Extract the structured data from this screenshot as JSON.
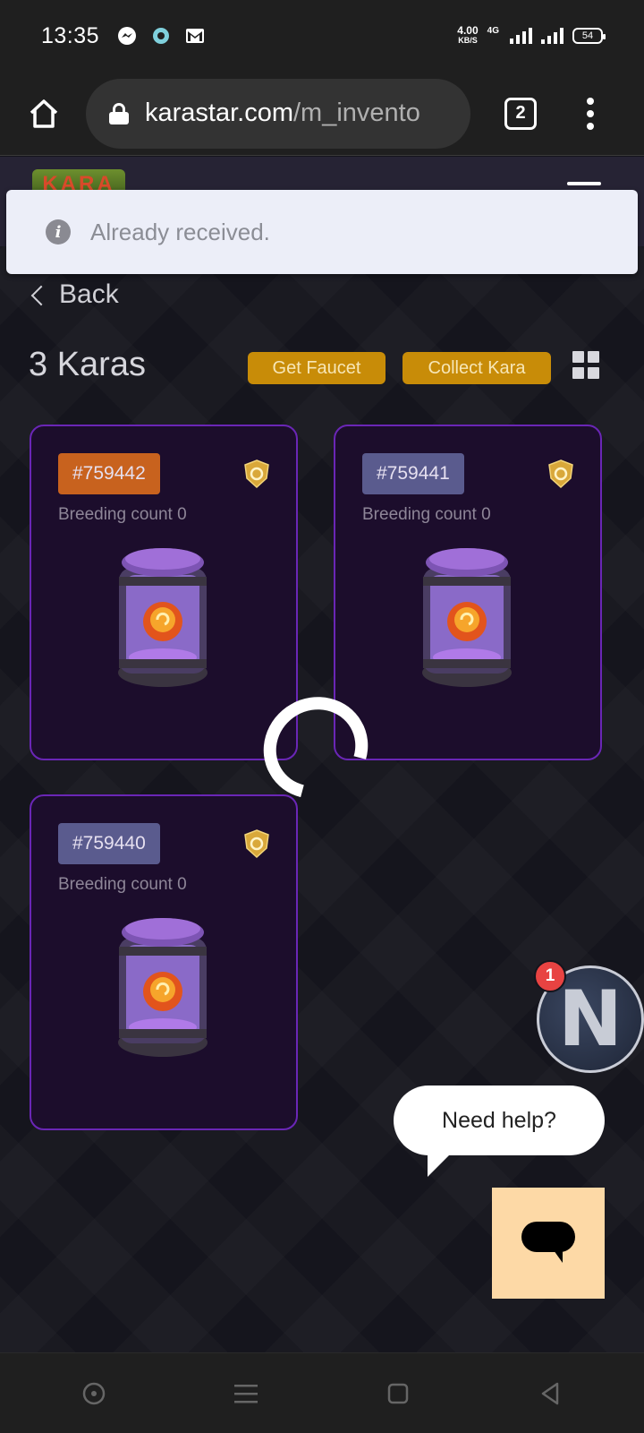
{
  "status_bar": {
    "time": "13:35",
    "net_speed_value": "4.00",
    "net_speed_unit": "KB/S",
    "network_type": "4G",
    "battery": "54",
    "notification_icons": [
      "messenger-icon",
      "circle-app-icon",
      "gmail-icon"
    ]
  },
  "browser": {
    "url_host": "karastar.com",
    "url_path": "/m_invento",
    "tab_count": "2"
  },
  "site": {
    "logo_text": "KARA"
  },
  "toast": {
    "message": "Already received."
  },
  "nav": {
    "back_label": "Back"
  },
  "inventory": {
    "count_title": "3 Karas",
    "get_faucet_label": "Get Faucet",
    "collect_label": "Collect Kara",
    "cards": [
      {
        "id": "#759442",
        "breeding": "Breeding count 0",
        "id_color": "#c8621e"
      },
      {
        "id": "#759441",
        "breeding": "Breeding count 0",
        "id_color": "#5a5b8e"
      },
      {
        "id": "#759440",
        "breeding": "Breeding count 0",
        "id_color": "#5a5b8e"
      }
    ]
  },
  "chat": {
    "avatar_letter": "N",
    "badge_count": "1",
    "help_text": "Need help?"
  },
  "colors": {
    "accent_gold": "#c88c08",
    "card_border": "#6a26b6",
    "card_bg": "#1c0d2c"
  }
}
